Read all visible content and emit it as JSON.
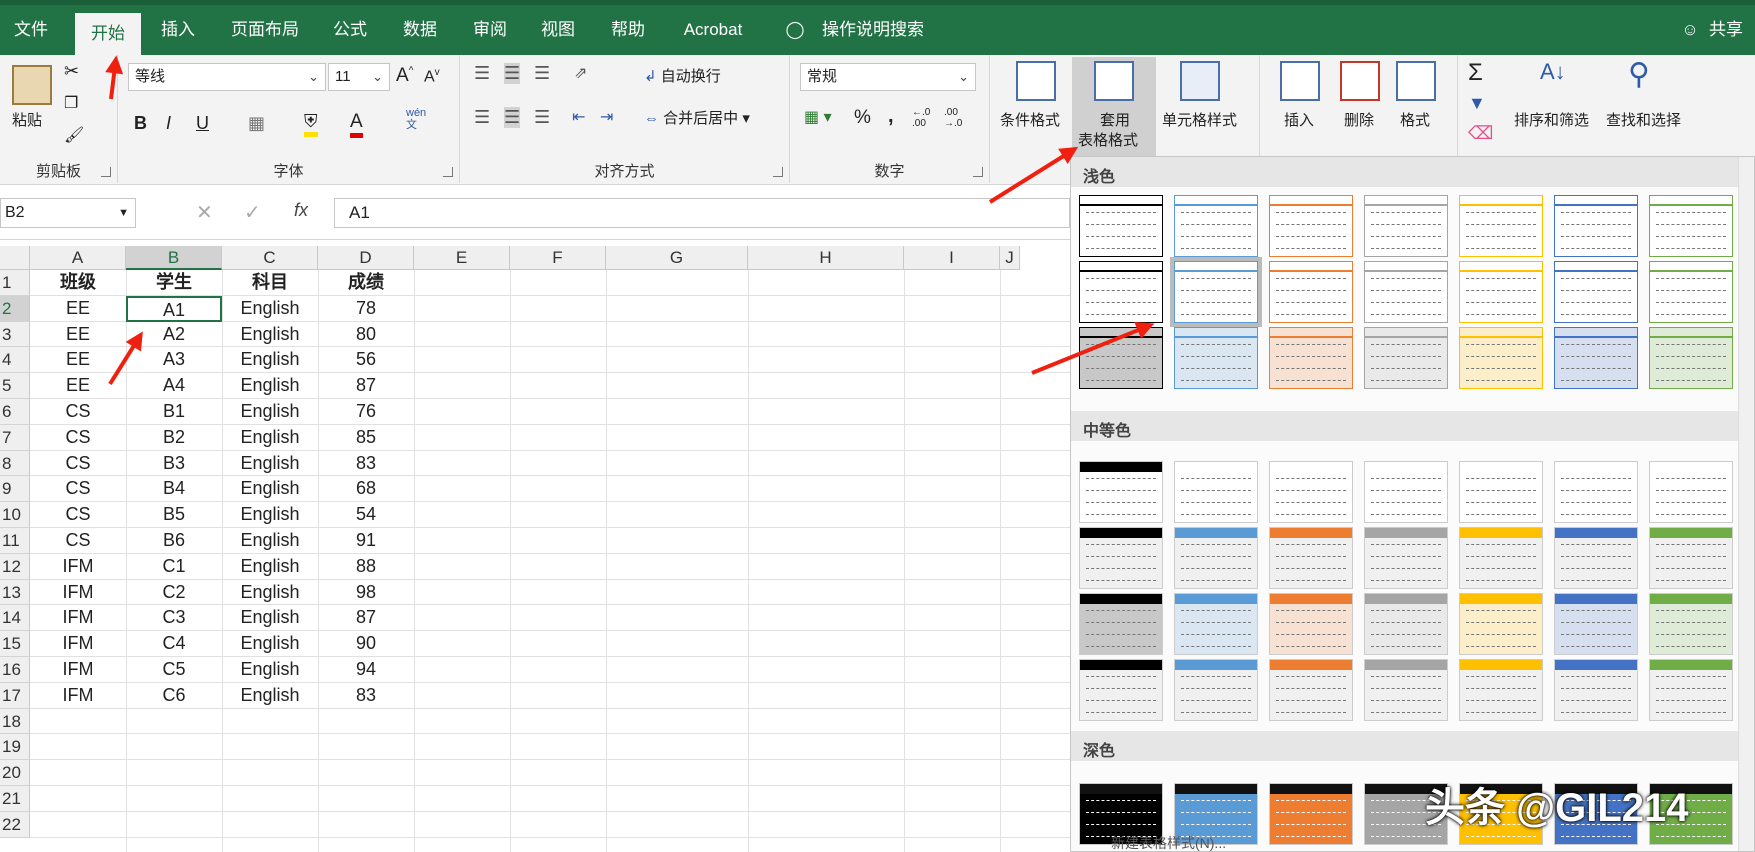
{
  "tabs": [
    "文件",
    "开始",
    "插入",
    "页面布局",
    "公式",
    "数据",
    "审阅",
    "视图",
    "帮助",
    "Acrobat"
  ],
  "tell_me": "操作说明搜索",
  "share": "共享",
  "clipboard": {
    "paste": "粘贴",
    "label": "剪贴板"
  },
  "font": {
    "name": "等线",
    "size": "11",
    "label": "字体",
    "wen": "wén\n文"
  },
  "align": {
    "wrap": "自动换行",
    "merge": "合并后居中",
    "label": "对齐方式"
  },
  "number": {
    "format": "常规",
    "label": "数字",
    "percent": "%",
    "comma": ","
  },
  "styles": {
    "cond": "条件格式",
    "table_format_1": "套用",
    "table_format_2": "表格格式",
    "cell_styles": "单元格样式"
  },
  "cells": {
    "insert": "插入",
    "delete": "删除",
    "format": "格式"
  },
  "editing": {
    "sort": "排序和筛选",
    "find": "查找和选择"
  },
  "formula_bar": {
    "name_box": "B2",
    "fx": "fx",
    "value": "A1"
  },
  "columns": [
    "A",
    "B",
    "C",
    "D",
    "E",
    "F",
    "G",
    "H",
    "I",
    "J"
  ],
  "rows": [
    "1",
    "2",
    "3",
    "4",
    "5",
    "6",
    "7",
    "8",
    "9",
    "10",
    "11",
    "12",
    "13",
    "14",
    "15",
    "16",
    "17",
    "18",
    "19",
    "20",
    "21",
    "22"
  ],
  "table": [
    [
      "班级",
      "学生",
      "科目",
      "成绩"
    ],
    [
      "EE",
      "A1",
      "English",
      "78"
    ],
    [
      "EE",
      "A2",
      "English",
      "80"
    ],
    [
      "EE",
      "A3",
      "English",
      "56"
    ],
    [
      "EE",
      "A4",
      "English",
      "87"
    ],
    [
      "CS",
      "B1",
      "English",
      "76"
    ],
    [
      "CS",
      "B2",
      "English",
      "85"
    ],
    [
      "CS",
      "B3",
      "English",
      "83"
    ],
    [
      "CS",
      "B4",
      "English",
      "68"
    ],
    [
      "CS",
      "B5",
      "English",
      "54"
    ],
    [
      "CS",
      "B6",
      "English",
      "91"
    ],
    [
      "IFM",
      "C1",
      "English",
      "88"
    ],
    [
      "IFM",
      "C2",
      "English",
      "98"
    ],
    [
      "IFM",
      "C3",
      "English",
      "87"
    ],
    [
      "IFM",
      "C4",
      "English",
      "90"
    ],
    [
      "IFM",
      "C5",
      "English",
      "94"
    ],
    [
      "IFM",
      "C6",
      "English",
      "83"
    ]
  ],
  "gallery": {
    "light": "浅色",
    "medium": "中等色",
    "dark": "深色",
    "new_style": "新建表格样式(N)..."
  },
  "swatch_colors": [
    "#000000",
    "#5b9bd5",
    "#ed7d31",
    "#a5a5a5",
    "#ffc000",
    "#4472c4",
    "#70ad47"
  ],
  "watermark": "头条 @GIL214"
}
